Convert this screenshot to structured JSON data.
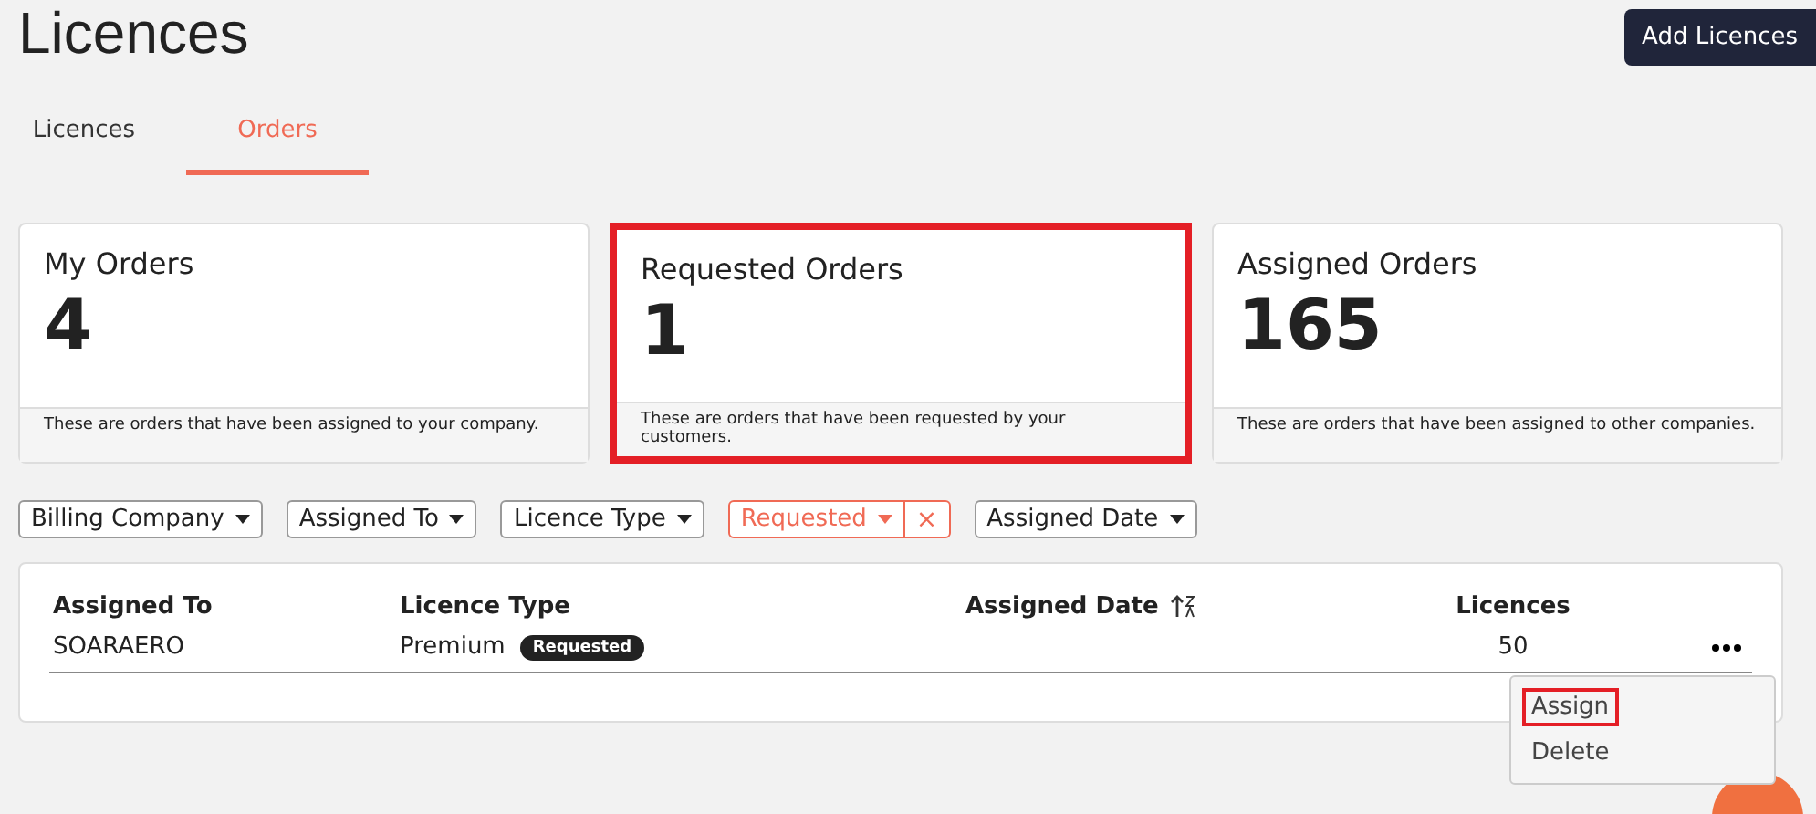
{
  "page_title": "Licences",
  "add_button": "Add Licences",
  "tabs": [
    {
      "label": "Licences",
      "selected": false
    },
    {
      "label": "Orders",
      "selected": true
    }
  ],
  "cards": [
    {
      "title": "My Orders",
      "count": "4",
      "description": "These are orders that have been assigned to your company.",
      "highlighted": false
    },
    {
      "title": "Requested Orders",
      "count": "1",
      "description": "These are orders that have been requested by your customers.",
      "highlighted": true
    },
    {
      "title": "Assigned Orders",
      "count": "165",
      "description": "These are orders that have been assigned to other companies.",
      "highlighted": false
    }
  ],
  "filters": [
    {
      "label": "Billing Company",
      "active": false
    },
    {
      "label": "Assigned To",
      "active": false
    },
    {
      "label": "Licence Type",
      "active": false
    },
    {
      "label": "Requested",
      "active": true,
      "clear": "×"
    },
    {
      "label": "Assigned Date",
      "active": false
    }
  ],
  "table": {
    "columns": [
      {
        "label": "Assigned To",
        "sortable": false
      },
      {
        "label": "Licence Type",
        "sortable": false
      },
      {
        "label": "Assigned Date",
        "sortable": true
      },
      {
        "label": "Licences",
        "sortable": false
      }
    ],
    "rows": [
      {
        "assigned_to": "SOARAERO",
        "licence_type": "Premium",
        "status": "Requested",
        "assigned_date": "",
        "licences": "50"
      }
    ]
  },
  "row_menu": [
    {
      "label": "Assign",
      "highlighted": true
    },
    {
      "label": "Delete",
      "highlighted": false
    }
  ]
}
